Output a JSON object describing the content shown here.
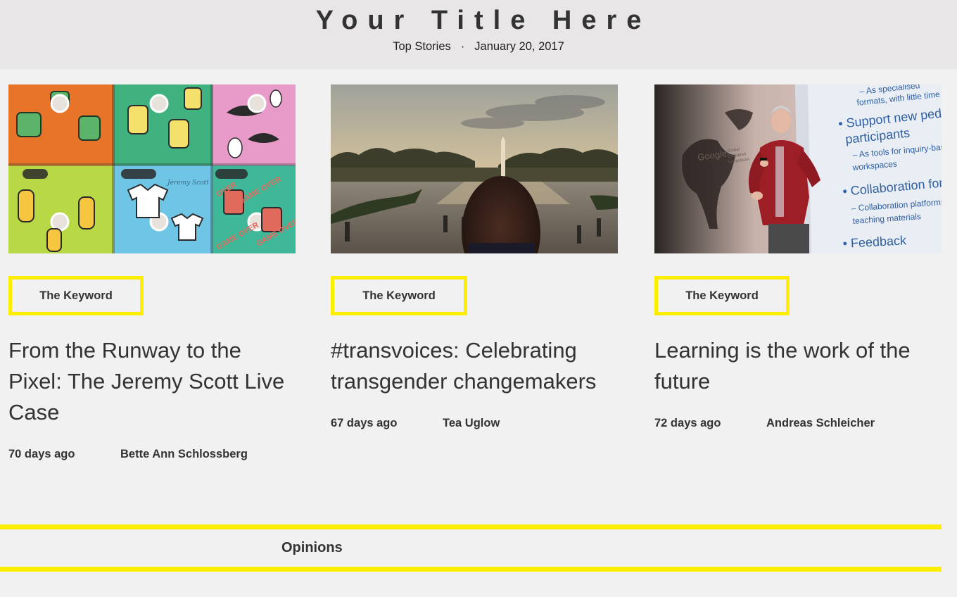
{
  "header": {
    "title": "Your Title Here",
    "section": "Top Stories",
    "separator": "·",
    "date": "January 20, 2017"
  },
  "articles": [
    {
      "keyword_label": "The Keyword",
      "headline": "From the Runway to the Pixel: The Jeremy Scott Live Case",
      "age": "70 days ago",
      "author": "Bette Ann Schlossberg",
      "image": "phone-cases-pattern-photo"
    },
    {
      "keyword_label": "The Keyword",
      "headline": "#transvoices: Celebrating transgender changemakers",
      "age": "67 days ago",
      "author": "Tea Uglow",
      "image": "washington-monument-photo"
    },
    {
      "keyword_label": "The Keyword",
      "headline": "Learning is the work of the future",
      "age": "72 days ago",
      "author": "Andreas Schleicher",
      "image": "speaker-on-stage-photo"
    }
  ],
  "slide_text": {
    "line1": "– As specialised",
    "line2": "formats, with little time a",
    "line3": "• Support new pedagog",
    "line4": "participants",
    "line5": "– As tools for inquiry-based",
    "line6": "workspaces",
    "line7": "• Collaboration for know",
    "line8": "– Collaboration platforms fo",
    "line9": "teaching materials",
    "line10": "• Feedback",
    "logo": "Google",
    "logo_sub1": "Global",
    "logo_sub2": "Education",
    "logo_sub3": "Symposium"
  },
  "phone_case_text": {
    "game_over": "GAME OVER",
    "over": "OVER",
    "brand": "Jeremy Scott"
  },
  "opinions": {
    "label": "Opinions"
  },
  "colors": {
    "accent": "#fdee00",
    "background": "#f0f1f0",
    "header_bg": "#e8e6e7",
    "text": "#333333"
  }
}
